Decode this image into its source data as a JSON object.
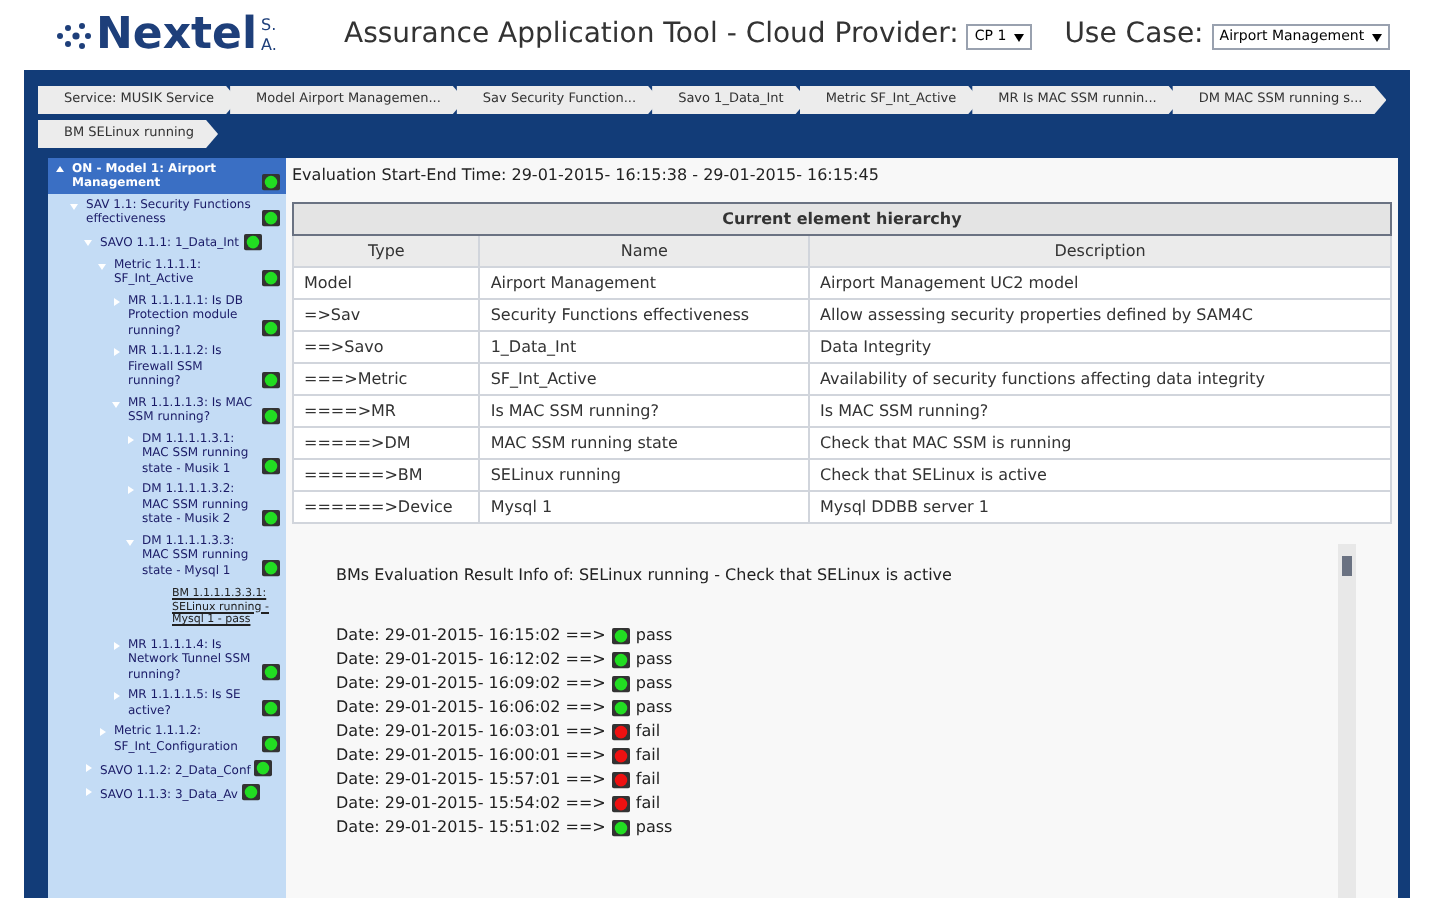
{
  "header": {
    "logo_text": "Nextel",
    "logo_suffix": "S.A.",
    "title": "Assurance Application Tool - Cloud Provider:",
    "provider_select": {
      "value": "CP 1"
    },
    "use_case_label": "Use Case:",
    "use_case_select": {
      "value": "Airport Management"
    }
  },
  "breadcrumbs": [
    {
      "label": "Service: MUSIK Service"
    },
    {
      "label": "Model Airport Managemen..."
    },
    {
      "label": "Sav Security Function..."
    },
    {
      "label": "Savo 1_Data_Int"
    },
    {
      "label": "Metric SF_Int_Active"
    },
    {
      "label": "MR Is MAC SSM runnin..."
    },
    {
      "label": "DM MAC SSM running s..."
    },
    {
      "label": "BM SELinux running"
    }
  ],
  "tree": [
    {
      "label": "ON - Model 1: Airport Management",
      "passed": true,
      "expanded": true,
      "selected": true,
      "children": [
        {
          "label": "SAV 1.1: Security Functions effectiveness",
          "passed": true,
          "expanded": true,
          "selected": false,
          "children": [
            {
              "label": "SAVO 1.1.1: 1_Data_Int",
              "passed": true,
              "expanded": true,
              "selected": false,
              "children": [
                {
                  "label": "Metric 1.1.1.1: SF_Int_Active",
                  "passed": true,
                  "expanded": true,
                  "selected": false,
                  "children": [
                    {
                      "label": "MR 1.1.1.1.1: Is DB Protection module running?",
                      "passed": true,
                      "expanded": false,
                      "selected": false
                    },
                    {
                      "label": "MR 1.1.1.1.2: Is Firewall SSM running?",
                      "passed": true,
                      "expanded": false,
                      "selected": false
                    },
                    {
                      "label": "MR 1.1.1.1.3: Is MAC SSM running?",
                      "passed": true,
                      "expanded": true,
                      "selected": false,
                      "children": [
                        {
                          "label": "DM 1.1.1.1.3.1: MAC SSM running state - Musik 1",
                          "passed": true,
                          "expanded": false,
                          "selected": false
                        },
                        {
                          "label": "DM 1.1.1.1.3.2: MAC SSM running state - Musik 2",
                          "passed": true,
                          "expanded": false,
                          "selected": false
                        },
                        {
                          "label": "DM 1.1.1.1.3.3: MAC SSM running state - Mysql 1",
                          "passed": true,
                          "expanded": true,
                          "selected": false,
                          "children": [
                            {
                              "label": "BM 1.1.1.1.3.3.1: SELinux running - Mysql 1 - pass",
                              "kind": "link",
                              "selected": false
                            }
                          ]
                        }
                      ]
                    },
                    {
                      "label": "MR 1.1.1.1.4: Is Network Tunnel SSM running?",
                      "passed": true,
                      "expanded": false,
                      "selected": false
                    },
                    {
                      "label": "MR 1.1.1.1.5: Is SE active?",
                      "passed": true,
                      "expanded": false,
                      "selected": false
                    }
                  ]
                },
                {
                  "label": "Metric 1.1.1.2: SF_Int_Configuration",
                  "passed": true,
                  "expanded": false,
                  "selected": false
                }
              ]
            },
            {
              "label": "SAVO 1.1.2: 2_Data_Conf",
              "passed": true,
              "expanded": false,
              "selected": false
            },
            {
              "label": "SAVO 1.1.3: 3_Data_Av",
              "passed": true,
              "expanded": false,
              "selected": false
            }
          ]
        }
      ]
    }
  ],
  "evaluation_time": "Evaluation Start-End Time: 29-01-2015- 16:15:38 - 29-01-2015- 16:15:45",
  "hierarchy_table": {
    "title": "Current element hierarchy",
    "columns": [
      "Type",
      "Name",
      "Description"
    ],
    "rows": [
      [
        "Model",
        "Airport Management",
        "Airport Management UC2 model"
      ],
      [
        "=>Sav",
        "Security Functions effectiveness",
        "Allow assessing security properties defined by SAM4C"
      ],
      [
        "==>Savo",
        "1_Data_Int",
        "Data Integrity"
      ],
      [
        "===>Metric",
        "SF_Int_Active",
        "Availability of security functions affecting data integrity"
      ],
      [
        "====>MR",
        "Is MAC SSM running?",
        "Is MAC SSM running?"
      ],
      [
        "=====>DM",
        "MAC SSM running state",
        "Check that MAC SSM is running"
      ],
      [
        "======>BM",
        "SELinux running",
        "Check that SELinux is active"
      ],
      [
        "======>Device",
        "Mysql 1",
        "Mysql DDBB server 1"
      ]
    ]
  },
  "results": {
    "title": "BMs Evaluation Result Info of: SELinux running - Check that SELinux is active",
    "entries": [
      {
        "date": "Date: 29-01-2015- 16:15:02 ==>",
        "status": "pass"
      },
      {
        "date": "Date: 29-01-2015- 16:12:02 ==>",
        "status": "pass"
      },
      {
        "date": "Date: 29-01-2015- 16:09:02 ==>",
        "status": "pass"
      },
      {
        "date": "Date: 29-01-2015- 16:06:02 ==>",
        "status": "pass"
      },
      {
        "date": "Date: 29-01-2015- 16:03:01 ==>",
        "status": "fail"
      },
      {
        "date": "Date: 29-01-2015- 16:00:01 ==>",
        "status": "fail"
      },
      {
        "date": "Date: 29-01-2015- 15:57:01 ==>",
        "status": "fail"
      },
      {
        "date": "Date: 29-01-2015- 15:54:02 ==>",
        "status": "fail"
      },
      {
        "date": "Date: 29-01-2015- 15:51:02 ==>",
        "status": "pass"
      }
    ]
  }
}
